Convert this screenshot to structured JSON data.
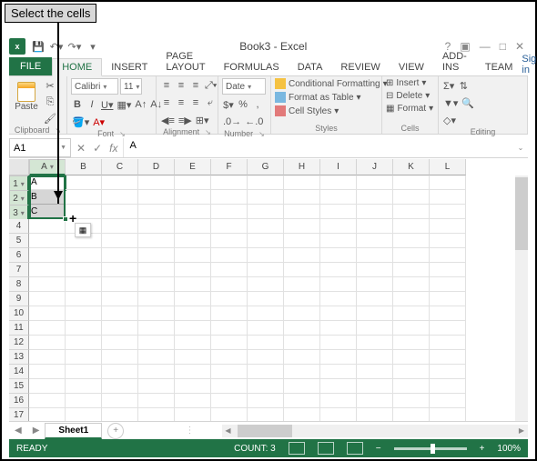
{
  "annotation": {
    "text": "Select the cells"
  },
  "app": {
    "title": "Book3 - Excel"
  },
  "qat": {
    "save_icon": "💾"
  },
  "tabs": {
    "file": "FILE",
    "home": "HOME",
    "insert": "INSERT",
    "page_layout": "PAGE LAYOUT",
    "formulas": "FORMULAS",
    "data": "DATA",
    "review": "REVIEW",
    "view": "VIEW",
    "addins": "ADD-INS",
    "team": "TEAM",
    "signin": "Sign in"
  },
  "ribbon": {
    "clipboard": {
      "paste": "Paste",
      "label": "Clipboard"
    },
    "font": {
      "name": "Calibri",
      "size": "11",
      "label": "Font"
    },
    "alignment": {
      "label": "Alignment"
    },
    "number": {
      "format": "Date",
      "label": "Number"
    },
    "styles": {
      "cond": "Conditional Formatting",
      "table": "Format as Table",
      "cell": "Cell Styles",
      "label": "Styles"
    },
    "cells": {
      "insert": "Insert",
      "delete": "Delete",
      "format": "Format",
      "label": "Cells"
    },
    "editing": {
      "label": "Editing"
    }
  },
  "formula_bar": {
    "name_box": "A1",
    "fx": "fx",
    "value": "A"
  },
  "grid": {
    "cols": [
      "A",
      "B",
      "C",
      "D",
      "E",
      "F",
      "G",
      "H",
      "I",
      "J",
      "K",
      "L"
    ],
    "row_count": 18,
    "cells": {
      "A1": "A",
      "A2": "B",
      "A3": "C"
    },
    "selection": {
      "start": "A1",
      "end": "A3",
      "active": "A1"
    }
  },
  "sheets": {
    "active": "Sheet1"
  },
  "status": {
    "ready": "READY",
    "count_label": "COUNT:",
    "count": "3",
    "zoom": "100%"
  }
}
